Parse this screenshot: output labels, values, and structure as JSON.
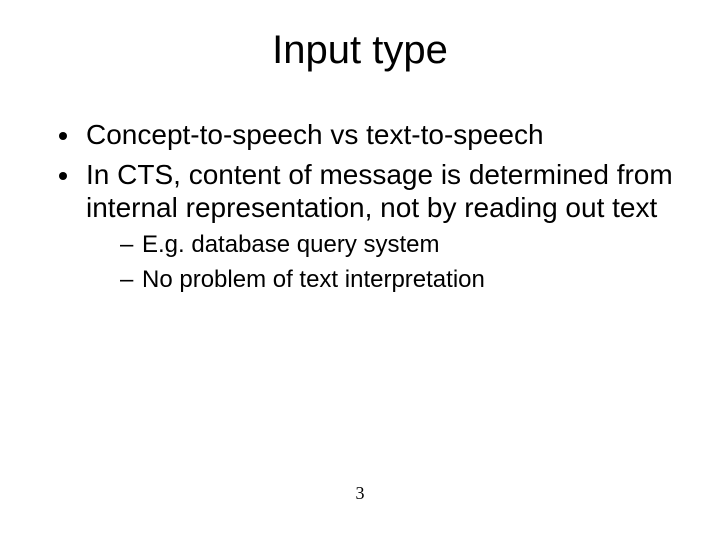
{
  "title": "Input type",
  "bullets": [
    {
      "text": "Concept-to-speech vs text-to-speech"
    },
    {
      "text": "In CTS, content of message is determined from internal representation, not by reading out text",
      "sub": [
        "E.g. database query system",
        "No problem of text interpretation"
      ]
    }
  ],
  "page_number": "3"
}
